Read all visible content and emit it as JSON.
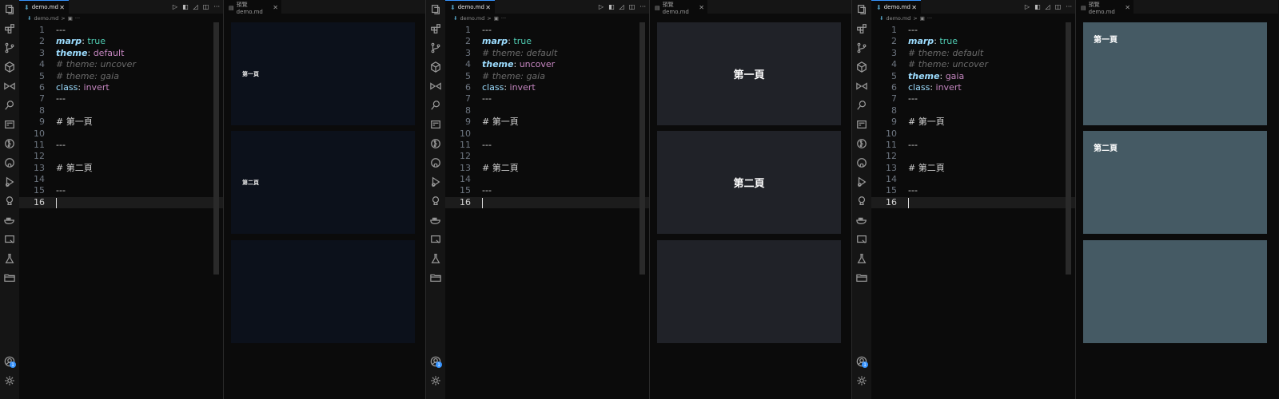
{
  "file_name": "demo.md",
  "preview_tab_label": "預覽 demo.md",
  "close_glyph": "✕",
  "more_glyph": "···",
  "breadcrumb_sep": ">",
  "icons": [
    "explorer-icon",
    "extensions-icon",
    "source-control-icon",
    "package-icon",
    "live-share-icon",
    "search-icon",
    "remote-icon",
    "git-graph-icon",
    "github-icon",
    "run-debug-icon",
    "testing-icon",
    "docker-icon",
    "remote-explorer-icon",
    "flask-icon",
    "folder-icon"
  ],
  "bottom_icons": [
    "accounts-icon",
    "gear-icon"
  ],
  "panes": [
    {
      "lines": [
        {
          "n": "1",
          "parts": [
            {
              "t": "---",
              "c": "c-default"
            }
          ]
        },
        {
          "n": "2",
          "parts": [
            {
              "t": "marp",
              "c": "c-key"
            },
            {
              "t": ": ",
              "c": "c-default"
            },
            {
              "t": "true",
              "c": "c-teal"
            }
          ]
        },
        {
          "n": "3",
          "parts": [
            {
              "t": "theme",
              "c": "c-key"
            },
            {
              "t": ": ",
              "c": "c-default"
            },
            {
              "t": "default",
              "c": "c-pink"
            }
          ]
        },
        {
          "n": "4",
          "parts": [
            {
              "t": "# theme: uncover",
              "c": "c-comment"
            }
          ]
        },
        {
          "n": "5",
          "parts": [
            {
              "t": "# theme: gaia",
              "c": "c-comment"
            }
          ]
        },
        {
          "n": "6",
          "parts": [
            {
              "t": "class",
              "c": "c-key2"
            },
            {
              "t": ": ",
              "c": "c-default"
            },
            {
              "t": "invert",
              "c": "c-pink"
            }
          ]
        },
        {
          "n": "7",
          "parts": [
            {
              "t": "---",
              "c": "c-default"
            }
          ]
        },
        {
          "n": "8",
          "parts": []
        },
        {
          "n": "9",
          "parts": [
            {
              "t": "# 第一頁",
              "c": "c-default"
            }
          ]
        },
        {
          "n": "10",
          "parts": []
        },
        {
          "n": "11",
          "parts": [
            {
              "t": "---",
              "c": "c-default"
            }
          ]
        },
        {
          "n": "12",
          "parts": []
        },
        {
          "n": "13",
          "parts": [
            {
              "t": "# 第二頁",
              "c": "c-default"
            }
          ]
        },
        {
          "n": "14",
          "parts": []
        },
        {
          "n": "15",
          "parts": [
            {
              "t": "---",
              "c": "c-default"
            }
          ]
        },
        {
          "n": "16",
          "parts": []
        }
      ],
      "slides": [
        "第一頁",
        "第二頁",
        ""
      ]
    },
    {
      "lines": [
        {
          "n": "1",
          "parts": [
            {
              "t": "---",
              "c": "c-default"
            }
          ]
        },
        {
          "n": "2",
          "parts": [
            {
              "t": "marp",
              "c": "c-key"
            },
            {
              "t": ": ",
              "c": "c-default"
            },
            {
              "t": "true",
              "c": "c-teal"
            }
          ]
        },
        {
          "n": "3",
          "parts": [
            {
              "t": "# theme: default",
              "c": "c-comment"
            }
          ]
        },
        {
          "n": "4",
          "parts": [
            {
              "t": "theme",
              "c": "c-key"
            },
            {
              "t": ": ",
              "c": "c-default"
            },
            {
              "t": "uncover",
              "c": "c-pink"
            }
          ]
        },
        {
          "n": "5",
          "parts": [
            {
              "t": "# theme: gaia",
              "c": "c-comment"
            }
          ]
        },
        {
          "n": "6",
          "parts": [
            {
              "t": "class",
              "c": "c-key2"
            },
            {
              "t": ": ",
              "c": "c-default"
            },
            {
              "t": "invert",
              "c": "c-pink"
            }
          ]
        },
        {
          "n": "7",
          "parts": [
            {
              "t": "---",
              "c": "c-default"
            }
          ]
        },
        {
          "n": "8",
          "parts": []
        },
        {
          "n": "9",
          "parts": [
            {
              "t": "# 第一頁",
              "c": "c-default"
            }
          ]
        },
        {
          "n": "10",
          "parts": []
        },
        {
          "n": "11",
          "parts": [
            {
              "t": "---",
              "c": "c-default"
            }
          ]
        },
        {
          "n": "12",
          "parts": []
        },
        {
          "n": "13",
          "parts": [
            {
              "t": "# 第二頁",
              "c": "c-default"
            }
          ]
        },
        {
          "n": "14",
          "parts": []
        },
        {
          "n": "15",
          "parts": [
            {
              "t": "---",
              "c": "c-default"
            }
          ]
        },
        {
          "n": "16",
          "parts": []
        }
      ],
      "slides": [
        "第一頁",
        "第二頁",
        ""
      ]
    },
    {
      "lines": [
        {
          "n": "1",
          "parts": [
            {
              "t": "---",
              "c": "c-default"
            }
          ]
        },
        {
          "n": "2",
          "parts": [
            {
              "t": "marp",
              "c": "c-key"
            },
            {
              "t": ": ",
              "c": "c-default"
            },
            {
              "t": "true",
              "c": "c-teal"
            }
          ]
        },
        {
          "n": "3",
          "parts": [
            {
              "t": "# theme: default",
              "c": "c-comment"
            }
          ]
        },
        {
          "n": "4",
          "parts": [
            {
              "t": "# theme: uncover",
              "c": "c-comment"
            }
          ]
        },
        {
          "n": "5",
          "parts": [
            {
              "t": "theme",
              "c": "c-key"
            },
            {
              "t": ": ",
              "c": "c-default"
            },
            {
              "t": "gaia",
              "c": "c-pink"
            }
          ]
        },
        {
          "n": "6",
          "parts": [
            {
              "t": "class",
              "c": "c-key2"
            },
            {
              "t": ": ",
              "c": "c-default"
            },
            {
              "t": "invert",
              "c": "c-pink"
            }
          ]
        },
        {
          "n": "7",
          "parts": [
            {
              "t": "---",
              "c": "c-default"
            }
          ]
        },
        {
          "n": "8",
          "parts": []
        },
        {
          "n": "9",
          "parts": [
            {
              "t": "# 第一頁",
              "c": "c-default"
            }
          ]
        },
        {
          "n": "10",
          "parts": []
        },
        {
          "n": "11",
          "parts": [
            {
              "t": "---",
              "c": "c-default"
            }
          ]
        },
        {
          "n": "12",
          "parts": []
        },
        {
          "n": "13",
          "parts": [
            {
              "t": "# 第二頁",
              "c": "c-default"
            }
          ]
        },
        {
          "n": "14",
          "parts": []
        },
        {
          "n": "15",
          "parts": [
            {
              "t": "---",
              "c": "c-default"
            }
          ]
        },
        {
          "n": "16",
          "parts": []
        }
      ],
      "slides": [
        "第一頁",
        "第二頁",
        ""
      ]
    }
  ],
  "slide_themes": [
    {
      "bg": "#0c111b",
      "color": "#e6e6e6",
      "align": "left-small"
    },
    {
      "bg": "#202228",
      "color": "#ffffff",
      "align": "center"
    },
    {
      "bg": "#455a64",
      "color": "#ffffff",
      "align": "top-left"
    }
  ]
}
